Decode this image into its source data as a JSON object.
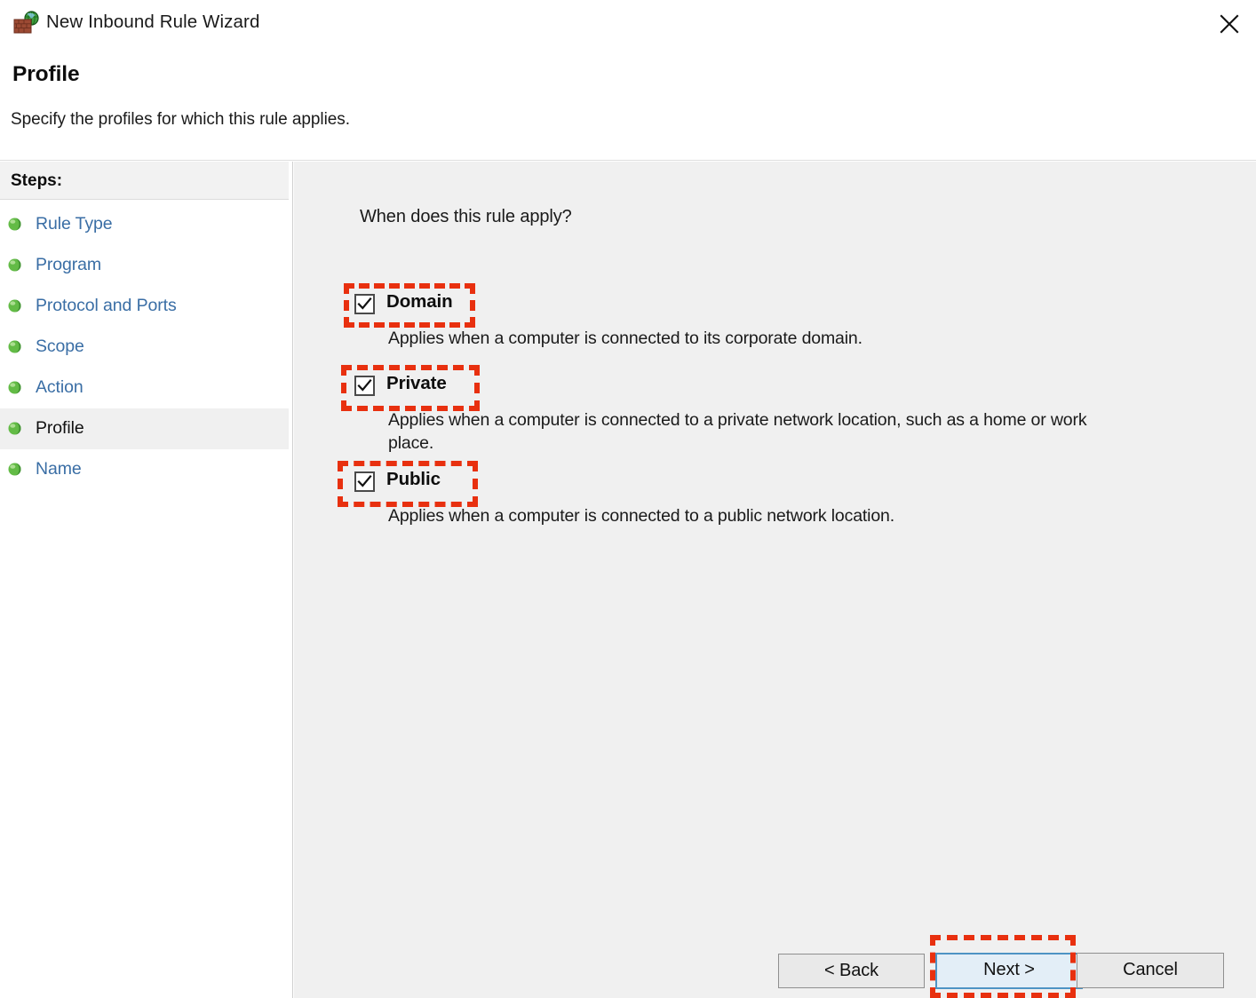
{
  "window": {
    "title": "New Inbound Rule Wizard",
    "app_icon": "firewall-globe-icon",
    "close_label": "✕"
  },
  "header": {
    "heading": "Profile",
    "subheading": "Specify the profiles for which this rule applies."
  },
  "sidebar": {
    "header_label": "Steps:",
    "items": [
      {
        "label": "Rule Type",
        "active": false
      },
      {
        "label": "Program",
        "active": false
      },
      {
        "label": "Protocol and Ports",
        "active": false
      },
      {
        "label": "Scope",
        "active": false
      },
      {
        "label": "Action",
        "active": false
      },
      {
        "label": "Profile",
        "active": true
      },
      {
        "label": "Name",
        "active": false
      }
    ]
  },
  "main": {
    "question": "When does this rule apply?",
    "profiles": [
      {
        "label": "Domain",
        "checked": true,
        "description": "Applies when a computer is connected to its corporate domain."
      },
      {
        "label": "Private",
        "checked": true,
        "description": "Applies when a computer is connected to a private network location, such as a home or work place."
      },
      {
        "label": "Public",
        "checked": true,
        "description": "Applies when a computer is connected to a public network location."
      }
    ]
  },
  "footer": {
    "back_label": "< Back",
    "next_label": "Next >",
    "cancel_label": "Cancel"
  },
  "annotations": {
    "highlight_color": "#e8300f",
    "targets": [
      "domain-checkbox",
      "private-checkbox",
      "public-checkbox",
      "next-button"
    ]
  }
}
